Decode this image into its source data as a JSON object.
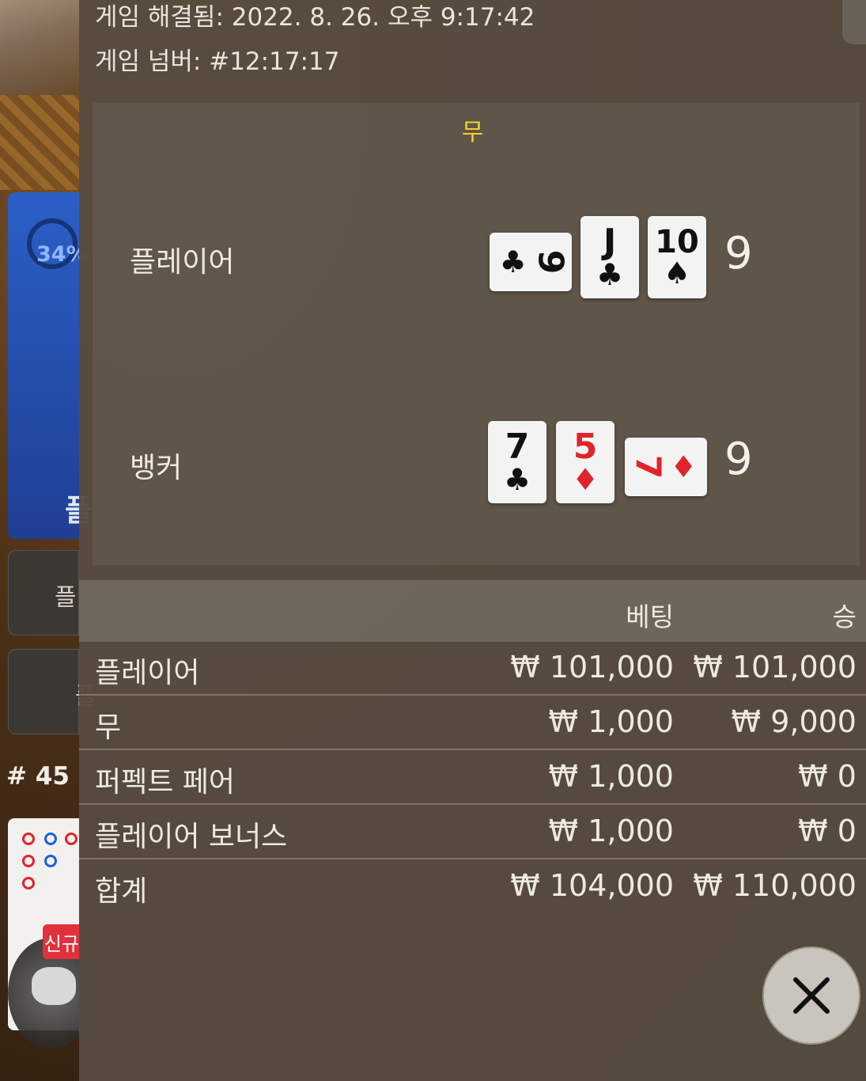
{
  "background": {
    "progress_percent_label": "34%",
    "player_bet_glyph": "플",
    "side_button_1_glyph": "플",
    "side_button_2_glyph": "플",
    "round_label": "# 45",
    "new_badge": "신규"
  },
  "header": {
    "resolved_label": "게임 해결됨: 2022. 8. 26. 오후 9:17:42",
    "game_number_label": "게임 넘버: #12:17:17"
  },
  "result": {
    "outcome": "무",
    "player": {
      "label": "플레이어",
      "score": "9",
      "cards": [
        {
          "rank": "9",
          "suit": "♣",
          "color": "black",
          "orientation": "sideways"
        },
        {
          "rank": "J",
          "suit": "♣",
          "color": "black",
          "orientation": "upright"
        },
        {
          "rank": "10",
          "suit": "♠",
          "color": "black",
          "orientation": "upright"
        }
      ]
    },
    "banker": {
      "label": "뱅커",
      "score": "9",
      "cards": [
        {
          "rank": "7",
          "suit": "♣",
          "color": "black",
          "orientation": "upright"
        },
        {
          "rank": "5",
          "suit": "♦",
          "color": "red",
          "orientation": "upright"
        },
        {
          "rank": "7",
          "suit": "♦",
          "color": "red",
          "orientation": "sideways"
        }
      ]
    }
  },
  "bets": {
    "columns": {
      "bet": "베팅",
      "win": "승"
    },
    "rows": [
      {
        "name": "플레이어",
        "bet": "₩ 101,000",
        "win": "₩ 101,000"
      },
      {
        "name": "무",
        "bet": "₩ 1,000",
        "win": "₩ 9,000"
      },
      {
        "name": "퍼펙트 페어",
        "bet": "₩ 1,000",
        "win": "₩ 0"
      },
      {
        "name": "플레이어 보너스",
        "bet": "₩ 1,000",
        "win": "₩ 0"
      }
    ],
    "total": {
      "name": "합계",
      "bet": "₩ 104,000",
      "win": "₩ 110,000"
    }
  },
  "close_icon": "close-icon",
  "colors": {
    "outcome": "#f4d228",
    "red_suit": "#e0242b",
    "player_panel": "#2c5fc7"
  }
}
